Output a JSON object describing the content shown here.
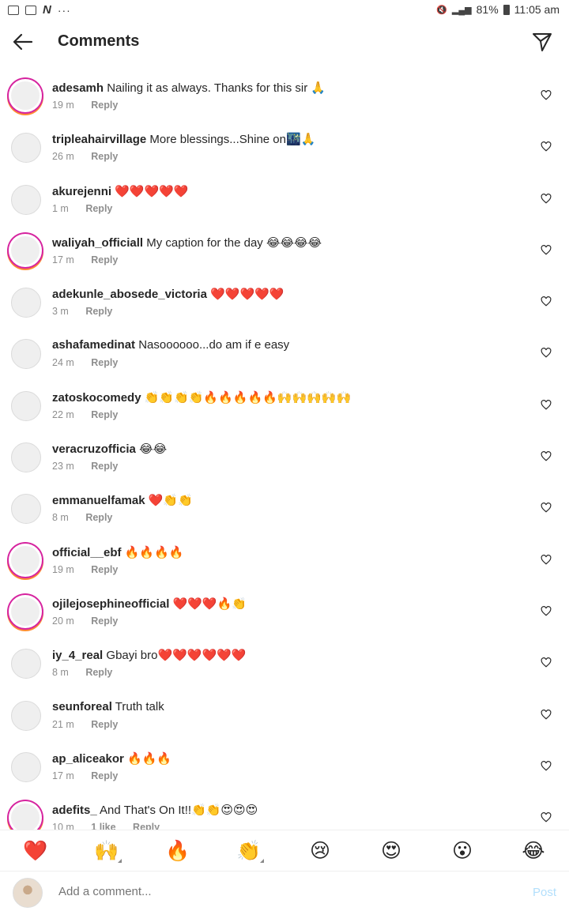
{
  "status": {
    "left_icons": [
      "image-icon",
      "cast-icon",
      "n-app-icon"
    ],
    "n_label": "N",
    "dots": "···",
    "battery": "81%",
    "time": "11:05 am"
  },
  "header": {
    "title": "Comments"
  },
  "reply_label": "Reply",
  "comments": [
    {
      "user": "adesamh",
      "text": "Nailing it as always. Thanks for this sir 🙏",
      "time": "19 m",
      "ring": true
    },
    {
      "user": "tripleahairvillage",
      "text": "More blessings...Shine on🌃🙏",
      "time": "26 m",
      "ring": false
    },
    {
      "user": "akurejenni",
      "text": "❤️❤️❤️❤️❤️",
      "time": "1 m",
      "ring": false
    },
    {
      "user": "waliyah_officiall",
      "text": "My caption for the day 😂😂😂😂",
      "time": "17 m",
      "ring": true
    },
    {
      "user": "adekunle_abosede_victoria",
      "text": "❤️❤️❤️❤️❤️",
      "time": "3 m",
      "ring": false
    },
    {
      "user": "ashafamedinat",
      "text": "Nasoooooo...do am if e easy",
      "time": "24 m",
      "ring": false
    },
    {
      "user": "zatoskocomedy",
      "text": "👏👏👏👏🔥🔥🔥🔥🔥🙌🙌🙌🙌🙌",
      "time": "22 m",
      "ring": false
    },
    {
      "user": "veracruzofficia",
      "text": "😂😂",
      "time": "23 m",
      "ring": false
    },
    {
      "user": "emmanuelfamak",
      "text": "❤️👏👏",
      "time": "8 m",
      "ring": false
    },
    {
      "user": "official__ebf",
      "text": "🔥🔥🔥🔥",
      "time": "19 m",
      "ring": true
    },
    {
      "user": "ojilejosephineofficial",
      "text": "❤️❤️❤️🔥👏",
      "time": "20 m",
      "ring": true
    },
    {
      "user": "iy_4_real",
      "text": "Gbayi bro❤️❤️❤️❤️❤️❤️",
      "time": "8 m",
      "ring": false
    },
    {
      "user": "seunforeal",
      "text": "Truth talk",
      "time": "21 m",
      "ring": false
    },
    {
      "user": "ap_aliceakor",
      "text": "🔥🔥🔥",
      "time": "17 m",
      "ring": false
    },
    {
      "user": "adefits_",
      "text": "And That's On It!!👏👏😍😍😍",
      "time": "10 m",
      "likes": "1 like",
      "ring": true
    }
  ],
  "emoji_bar": [
    "❤️",
    "🙌",
    "🔥",
    "👏",
    "😢",
    "😍",
    "😮",
    "😂"
  ],
  "composer": {
    "placeholder": "Add a comment...",
    "post": "Post"
  }
}
